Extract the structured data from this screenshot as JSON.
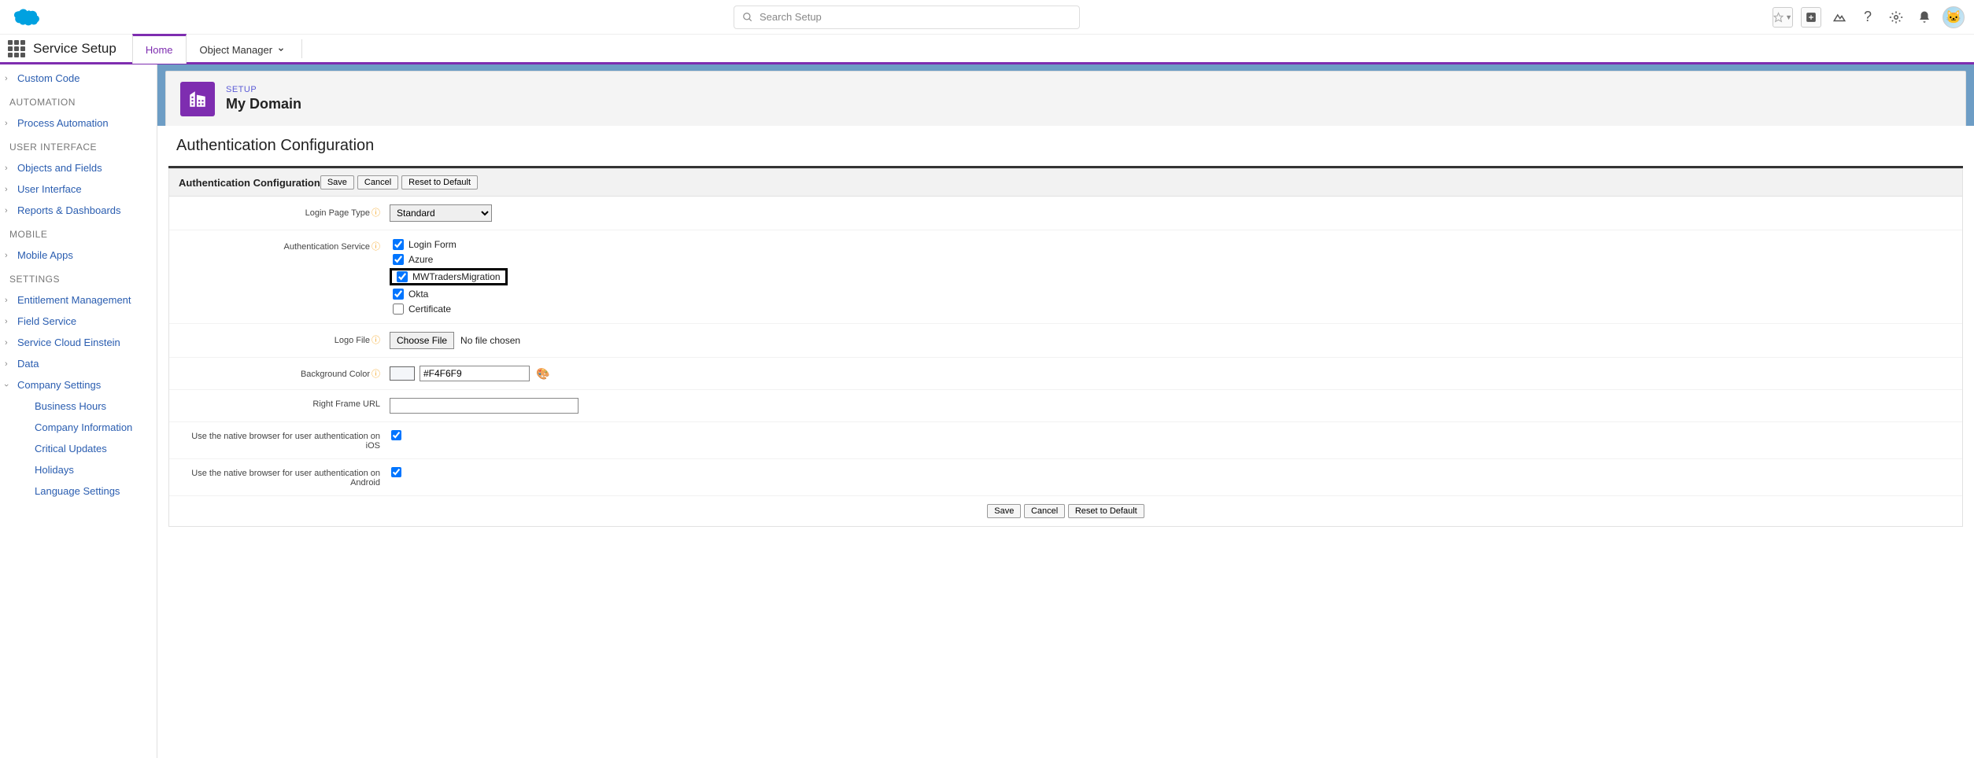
{
  "header": {
    "search_placeholder": "Search Setup"
  },
  "nav": {
    "app_name": "Service Setup",
    "tabs": {
      "home": "Home",
      "object_manager": "Object Manager"
    }
  },
  "sidebar": {
    "custom_code": "Custom Code",
    "automation_heading": "AUTOMATION",
    "process_automation": "Process Automation",
    "ui_heading": "USER INTERFACE",
    "objects_fields": "Objects and Fields",
    "user_interface": "User Interface",
    "reports_dashboards": "Reports & Dashboards",
    "mobile_heading": "MOBILE",
    "mobile_apps": "Mobile Apps",
    "settings_heading": "SETTINGS",
    "entitlement": "Entitlement Management",
    "field_service": "Field Service",
    "service_cloud": "Service Cloud Einstein",
    "data": "Data",
    "company_settings": "Company Settings",
    "business_hours": "Business Hours",
    "company_info": "Company Information",
    "critical_updates": "Critical Updates",
    "holidays": "Holidays",
    "language_settings": "Language Settings"
  },
  "page": {
    "kicker": "SETUP",
    "title": "My Domain"
  },
  "section": {
    "title": "Authentication Configuration",
    "form_title": "Authentication Configuration",
    "buttons": {
      "save": "Save",
      "cancel": "Cancel",
      "reset": "Reset to Default"
    }
  },
  "form": {
    "login_page_type_label": "Login Page Type",
    "login_page_type_value": "Standard",
    "auth_service_label": "Authentication Service",
    "auth_services": {
      "login_form": "Login Form",
      "azure": "Azure",
      "mwtraders": "MWTradersMigration",
      "okta": "Okta",
      "certificate": "Certificate"
    },
    "logo_file_label": "Logo File",
    "choose_file": "Choose File",
    "no_file": "No file chosen",
    "bg_color_label": "Background Color",
    "bg_color_value": "#F4F6F9",
    "right_frame_label": "Right Frame URL",
    "ios_label": "Use the native browser for user authentication on iOS",
    "android_label": "Use the native browser for user authentication on Android"
  }
}
